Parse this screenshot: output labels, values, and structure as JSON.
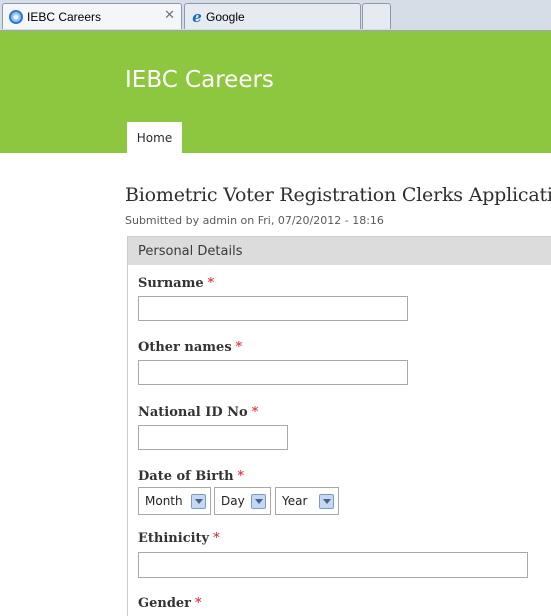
{
  "browser": {
    "tabs": [
      {
        "label": "IEBC Careers",
        "active": true,
        "icon": "ie-page-icon"
      },
      {
        "label": "Google",
        "active": false,
        "icon": "ie-e-icon"
      }
    ],
    "close_glyph": "✕",
    "favicon_letter": "e"
  },
  "site": {
    "name": "IEBC Careers",
    "header_color": "#8dc63f",
    "nav": [
      {
        "label": "Home"
      }
    ]
  },
  "node": {
    "title": "Biometric Voter Registration Clerks Application",
    "submitted": "Submitted by admin on Fri, 07/20/2012 - 18:16"
  },
  "form": {
    "fieldset_legend": "Personal Details",
    "required_marker": "*",
    "fields": {
      "surname": {
        "label": "Surname",
        "value": ""
      },
      "other_names": {
        "label": "Other names",
        "value": ""
      },
      "national_id": {
        "label": "National ID No",
        "value": ""
      },
      "dob": {
        "label": "Date of Birth",
        "month": "Month",
        "day": "Day",
        "year": "Year"
      },
      "ethnicity": {
        "label": "Ethinicity",
        "value": ""
      },
      "gender": {
        "label": "Gender"
      }
    }
  }
}
